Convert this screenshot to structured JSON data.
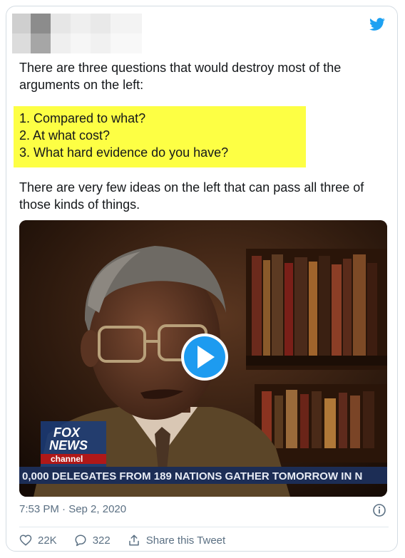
{
  "tweet": {
    "intro": "There are three questions that would destroy most of the arguments on the left:",
    "questions": [
      "1. Compared to what?",
      "2. At what cost?",
      "3. What hard evidence do you have?"
    ],
    "closing": "There are very few ideas on the left that can pass all three of those kinds of things.",
    "timestamp": "7:53 PM · Sep 2, 2020"
  },
  "video": {
    "logo_line1": "FOX",
    "logo_line2": "NEWS",
    "logo_line3": "channel",
    "ticker": "0,000 DELEGATES FROM 189 NATIONS GATHER TOMORROW IN N"
  },
  "actions": {
    "likes": "22K",
    "replies": "322",
    "share_label": "Share this Tweet"
  },
  "colors": {
    "highlight": "#fdff44",
    "twitter_blue": "#1da1f2",
    "muted": "#5b7083"
  },
  "icons": [
    "twitter-bird-icon",
    "play-icon",
    "info-icon",
    "heart-icon",
    "reply-icon",
    "share-icon"
  ]
}
